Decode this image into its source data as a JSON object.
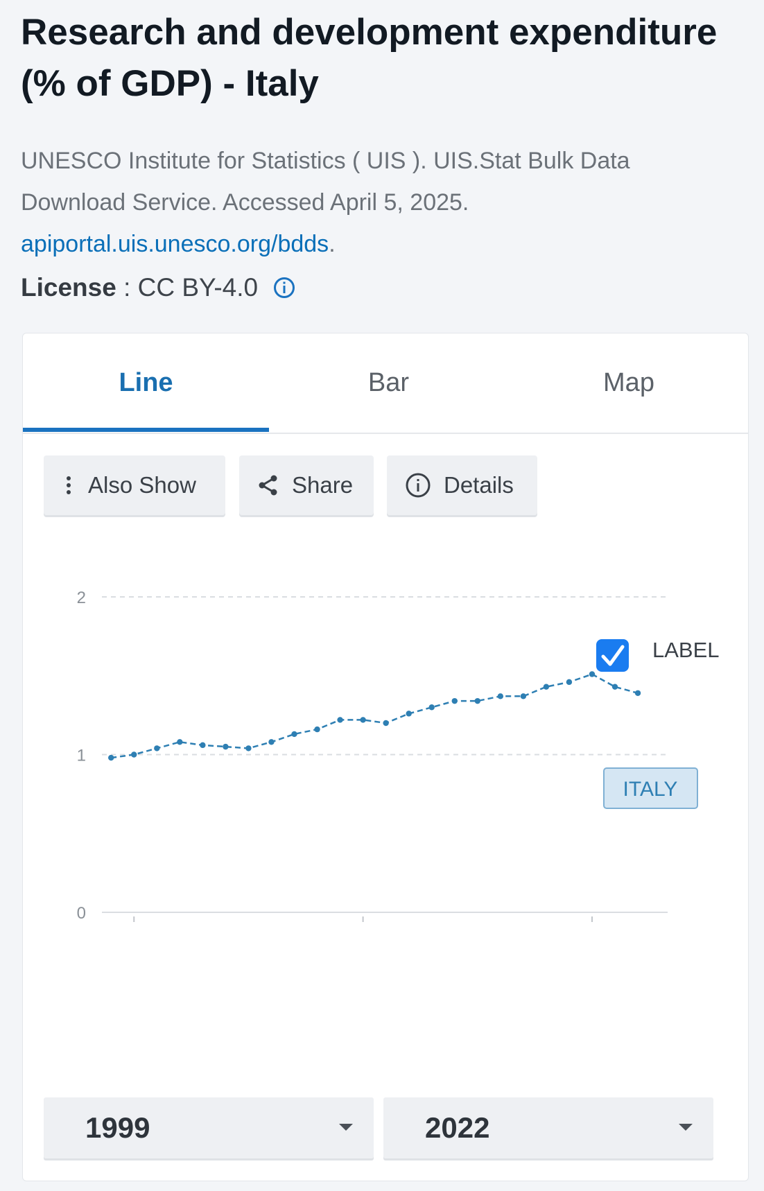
{
  "page": {
    "title": "Research and development expenditure (% of GDP) - Italy",
    "source_text": "UNESCO Institute for Statistics ( UIS ). UIS.Stat Bulk Data Download Service. Accessed April 5, 2025.",
    "source_link": "apiportal.uis.unesco.org/bdds",
    "source_link_suffix": ".",
    "license_label": "License",
    "license_sep": " : ",
    "license_value": "CC BY-4.0"
  },
  "tabs": [
    {
      "label": "Line",
      "active": true
    },
    {
      "label": "Bar",
      "active": false
    },
    {
      "label": "Map",
      "active": false
    }
  ],
  "toolbar": {
    "also_show": "Also Show",
    "share": "Share",
    "details": "Details"
  },
  "label_toggle": {
    "label": "LABEL",
    "checked": true
  },
  "range": {
    "from": "1999",
    "to": "2022"
  },
  "colors": {
    "accent": "#1a72c0",
    "series": "#2e7fb3",
    "label_bg": "#d5e6f3",
    "checkbox": "#1a7cf0"
  },
  "chart_data": {
    "type": "line",
    "x": [
      1999,
      2000,
      2001,
      2002,
      2003,
      2004,
      2005,
      2006,
      2007,
      2008,
      2009,
      2010,
      2011,
      2012,
      2013,
      2014,
      2015,
      2016,
      2017,
      2018,
      2019,
      2020,
      2021,
      2022
    ],
    "series": [
      {
        "name": "ITALY",
        "values": [
          0.98,
          1.0,
          1.04,
          1.08,
          1.06,
          1.05,
          1.04,
          1.08,
          1.13,
          1.16,
          1.22,
          1.22,
          1.2,
          1.26,
          1.3,
          1.34,
          1.34,
          1.37,
          1.37,
          1.43,
          1.46,
          1.51,
          1.43,
          1.39
        ]
      }
    ],
    "y_ticks": [
      "0",
      "1",
      "2"
    ],
    "ylim": [
      0,
      2
    ],
    "xlim": [
      1998.6,
      2023.3
    ],
    "x_ticks": [
      2000,
      2010,
      2020
    ],
    "title": "",
    "xlabel": "",
    "ylabel": "",
    "grid": true
  }
}
